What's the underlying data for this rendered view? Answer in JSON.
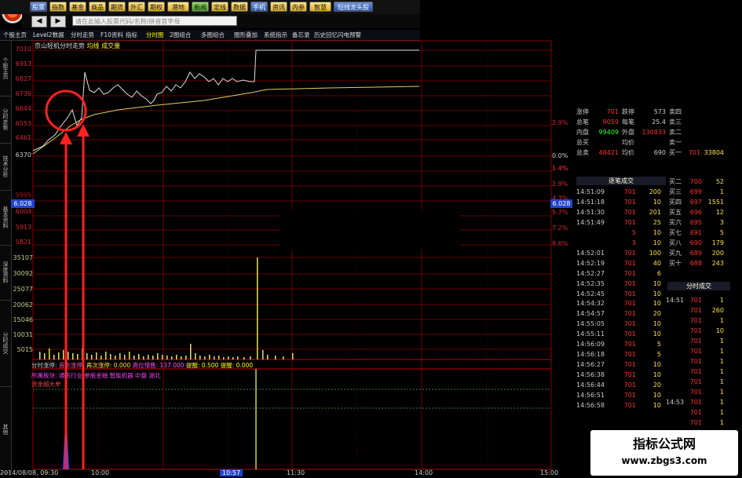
{
  "toolbar": {
    "buttons": [
      {
        "label": "股票",
        "style": "blue"
      },
      {
        "label": "指数",
        "style": "gold"
      },
      {
        "label": "基金",
        "style": "gold"
      },
      {
        "label": "商品",
        "style": "gold"
      },
      {
        "label": "期货",
        "style": "gold"
      },
      {
        "label": "外汇",
        "style": "gold"
      },
      {
        "label": "期权",
        "style": "gold"
      },
      {
        "label": "港地产",
        "style": "gold"
      },
      {
        "label": "新闻",
        "style": "green"
      },
      {
        "label": "定线",
        "style": "gold"
      },
      {
        "label": "数据",
        "style": "gold"
      },
      {
        "label": "手机",
        "style": "blue"
      },
      {
        "label": "资讯",
        "style": "gold"
      },
      {
        "label": "内参",
        "style": "gold"
      },
      {
        "label": "智慧家",
        "style": "gold"
      },
      {
        "label": "短线龙头股票选",
        "style": "blue"
      }
    ]
  },
  "nav": {
    "back": "◀",
    "forward": "▶",
    "search_placeholder": "请在此输入股票代码/名称/拼音首字母"
  },
  "tabs": [
    "个股主页",
    "Level2数据",
    "分时走势",
    "F10资料",
    "指标",
    "分时图",
    "2图组合",
    "多图组合",
    "图形叠加",
    "系统指示",
    "备忘录",
    "历史回忆",
    "闪电预警"
  ],
  "side_tabs": [
    "个股主页",
    "分时走势",
    "技术分析",
    "基本资料",
    "深度资料",
    "分时成交",
    "其他"
  ],
  "chart_caption": {
    "stock": "京山轻机分时走势",
    "indicator": "均线 成交量"
  },
  "price_axis": [
    "7010",
    "6913",
    "6827",
    "6736",
    "6644",
    "6553",
    "6461",
    "6370",
    "6028",
    "6004",
    "5913",
    "5821"
  ],
  "price_axis_faint": [
    "5995"
  ],
  "pct_axis": [
    "2.9%",
    "1.4%",
    "0.0%",
    "1.4%",
    "2.9%",
    "4.3%",
    "5.7%",
    "7.2%",
    "8.6%"
  ],
  "vol_axis": [
    "35107",
    "30092",
    "25077",
    "20062",
    "15046",
    "10031",
    "5015"
  ],
  "price_marker": {
    "left": "6.028",
    "right": "6.028"
  },
  "legend2": {
    "a": "分时涨停:",
    "b": "首次涨停:",
    "c": "再次涨停: 0.000",
    "d": "高位惜售: 137.000",
    "e": "提醒: 0.500",
    "f": "提醒: 0.000"
  },
  "legend3": "所属板块: 通讯行业 参股金融 智能机器 中盘 湖北",
  "legend4": "资金超大单",
  "xaxis": [
    "2014/08/08, 09:30",
    "10:00",
    "10:57",
    "11:30",
    "14:00",
    "15:00"
  ],
  "quote_top": [
    {
      "l": "涨停",
      "v": "701",
      "l2": "跌停",
      "v2": "573",
      "k": "卖四",
      "p": "",
      "q": ""
    },
    {
      "l": "总笔",
      "v": "9059",
      "l2": "每笔",
      "v2": "25.4",
      "k": "卖三",
      "p": "",
      "q": ""
    },
    {
      "l": "内盘",
      "v": "99409",
      "l2": "外盘",
      "v2": "130833",
      "k": "卖二",
      "p": "",
      "q": ""
    },
    {
      "l": "总买",
      "v": "",
      "l2": "均价",
      "v2": "",
      "k": "卖一",
      "p": "",
      "q": ""
    },
    {
      "l": "总卖",
      "v": "48421",
      "l2": "均价",
      "v2": "690",
      "k": "买一",
      "p": "701",
      "q": "33804"
    }
  ],
  "trades_header": "逐笔成交",
  "trades": [
    {
      "t": "14:51:09",
      "p": "701",
      "v": "200"
    },
    {
      "t": "14:51:18",
      "p": "701",
      "v": "10"
    },
    {
      "t": "14:51:30",
      "p": "701",
      "v": "201"
    },
    {
      "t": "14:51:49",
      "p": "701",
      "v": "25"
    },
    {
      "t": "",
      "p": "5",
      "v": "10"
    },
    {
      "t": "",
      "p": "3",
      "v": "10"
    },
    {
      "t": "14:52:01",
      "p": "701",
      "v": "100"
    },
    {
      "t": "14:52:19",
      "p": "701",
      "v": "40"
    },
    {
      "t": "14:52:27",
      "p": "701",
      "v": "6"
    },
    {
      "t": "14:52:35",
      "p": "701",
      "v": "10"
    },
    {
      "t": "14:52:45",
      "p": "701",
      "v": "10"
    },
    {
      "t": "14:54:32",
      "p": "701",
      "v": "10"
    },
    {
      "t": "14:54:57",
      "p": "701",
      "v": "20"
    },
    {
      "t": "14:55:05",
      "p": "701",
      "v": "10"
    },
    {
      "t": "14:55:11",
      "p": "701",
      "v": "10"
    },
    {
      "t": "14:56:09",
      "p": "701",
      "v": "5"
    },
    {
      "t": "14:56:18",
      "p": "701",
      "v": "5"
    },
    {
      "t": "14:56:27",
      "p": "701",
      "v": "10"
    },
    {
      "t": "14:56:38",
      "p": "701",
      "v": "10"
    },
    {
      "t": "14:56:44",
      "p": "701",
      "v": "20"
    },
    {
      "t": "14:56:51",
      "p": "701",
      "v": "10"
    },
    {
      "t": "14:56:58",
      "p": "701",
      "v": "10"
    }
  ],
  "bids": [
    {
      "k": "买二",
      "p": "700",
      "q": "52"
    },
    {
      "k": "买三",
      "p": "699",
      "q": "1"
    },
    {
      "k": "买四",
      "p": "697",
      "q": "1551"
    },
    {
      "k": "买五",
      "p": "696",
      "q": "12"
    },
    {
      "k": "买六",
      "p": "695",
      "q": "3"
    },
    {
      "k": "买七",
      "p": "691",
      "q": "5"
    },
    {
      "k": "买八",
      "p": "690",
      "q": "179"
    },
    {
      "k": "买九",
      "p": "689",
      "q": "200"
    },
    {
      "k": "买十",
      "p": "688",
      "q": "243"
    }
  ],
  "minute_header": "分时成交",
  "minutes": [
    {
      "t": "14:51",
      "p": "701",
      "v": "1"
    },
    {
      "t": "",
      "p": "701",
      "v": "260"
    },
    {
      "t": "",
      "p": "701",
      "v": "1"
    },
    {
      "t": "",
      "p": "701",
      "v": "10"
    },
    {
      "t": "",
      "p": "701",
      "v": "1"
    },
    {
      "t": "",
      "p": "701",
      "v": "1"
    },
    {
      "t": "",
      "p": "701",
      "v": "1"
    },
    {
      "t": "",
      "p": "701",
      "v": "1"
    },
    {
      "t": "",
      "p": "701",
      "v": "1"
    },
    {
      "t": "",
      "p": "701",
      "v": "1"
    },
    {
      "t": "14:53",
      "p": "701",
      "v": "1"
    },
    {
      "t": "",
      "p": "701",
      "v": "1"
    },
    {
      "t": "",
      "p": "701",
      "v": "1"
    }
  ],
  "watermark": {
    "title": "指标公式网",
    "url": "www.zbgs3.com"
  },
  "colors": {
    "grid": "#8a0000",
    "price_line": "#e0e0e0",
    "avg_line": "#e0d060",
    "annotation": "#ff2020",
    "volume": "#e8e060"
  }
}
